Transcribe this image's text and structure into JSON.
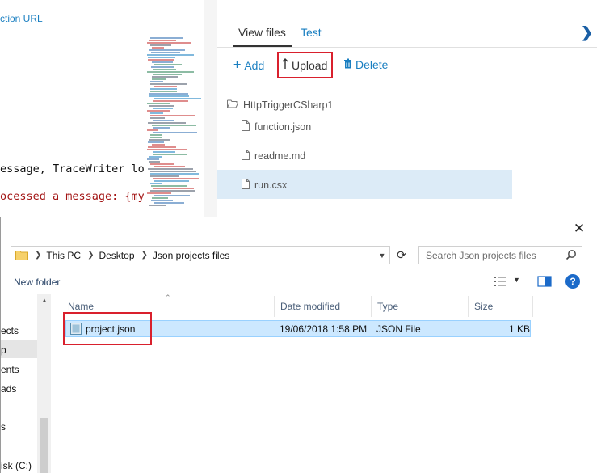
{
  "portal": {
    "function_url_label": "ction URL",
    "code_line_1": "essage, TraceWriter log)",
    "code_line_2": "ocessed a message: {myIc",
    "tabs": [
      {
        "label": "View files"
      },
      {
        "label": "Test"
      }
    ],
    "toolbar": {
      "add_label": "Add",
      "upload_label": "Upload",
      "delete_label": "Delete"
    },
    "folder_name": "HttpTriggerCSharp1",
    "files": [
      {
        "name": "function.json",
        "selected": false
      },
      {
        "name": "readme.md",
        "selected": false
      },
      {
        "name": "run.csx",
        "selected": true
      }
    ],
    "colors": {
      "link": "#1a7fc1",
      "selected_row": "#dcebf7",
      "highlight_box": "#d9202d"
    }
  },
  "dialog": {
    "breadcrumb": [
      "This PC",
      "Desktop",
      "Json projects files"
    ],
    "search_placeholder": "Search Json projects files",
    "new_folder_label": "New folder",
    "help_glyph": "?",
    "nav_items": [
      "ects",
      "p",
      "ents",
      "ads",
      "s",
      "isk (C:)"
    ],
    "columns": [
      "Name",
      "Date modified",
      "Type",
      "Size"
    ],
    "files": [
      {
        "name": "project.json",
        "date_modified": "19/06/2018 1:58 PM",
        "type": "JSON File",
        "size": "1 KB",
        "selected": true
      }
    ]
  }
}
